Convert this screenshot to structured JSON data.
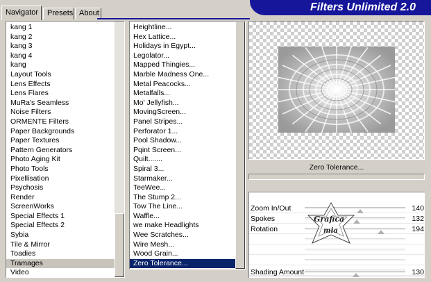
{
  "tabs": [
    {
      "label": "Navigator",
      "active": true
    },
    {
      "label": "Presets",
      "active": false
    },
    {
      "label": "About",
      "active": false
    }
  ],
  "app_title": "Filters Unlimited 2.0",
  "categories": {
    "items": [
      "kang 1",
      "kang 2",
      "kang 3",
      "kang 4",
      "kang",
      "Layout Tools",
      "Lens Effects",
      "Lens Flares",
      "MuRa's Seamless",
      "Noise Filters",
      "ORMENTE Filters",
      "Paper Backgrounds",
      "Paper Textures",
      "Pattern Generators",
      "Photo Aging Kit",
      "Photo Tools",
      "Pixellisation",
      "Psychosis",
      "Render",
      "ScreenWorks",
      "Special Effects 1",
      "Special Effects 2",
      "Sybia",
      "Tile & Mirror",
      "Toadies",
      "Tramages",
      "Video"
    ],
    "selected": "Tramages"
  },
  "filters": {
    "items": [
      "Heightline...",
      "Hex Lattice...",
      "Holidays in Egypt...",
      "Legolator...",
      "Mapped Thingies...",
      "Marble Madness One...",
      "Metal Peacocks...",
      "Metalfalls...",
      "Mo' Jellyfish...",
      "MovingScreen...",
      "Panel Stripes...",
      "Perforator 1...",
      "Pool Shadow...",
      "Pqint Screen...",
      "Quilt.......",
      "Spiral 3...",
      "Starmaker...",
      "TeeWee...",
      "The Stump 2...",
      "Tow The Line...",
      "Waffle...",
      "we make Headlights",
      "Wee Scratches...",
      "Wire Mesh...",
      "Wood Grain...",
      "Zero Tolerance..."
    ],
    "selected": "Zero Tolerance..."
  },
  "preview_filter_name": "Zero Tolerance...",
  "controls": [
    {
      "label": "Zoom In/Out",
      "value": "140",
      "level": 0.55
    },
    {
      "label": "Spokes",
      "value": "132",
      "level": 0.52
    },
    {
      "label": "Rotation",
      "value": "194",
      "level": 0.76
    },
    {
      "label": "",
      "value": "",
      "level": null
    },
    {
      "label": "",
      "value": "",
      "level": null
    },
    {
      "label": "",
      "value": "",
      "level": null
    },
    {
      "label": "",
      "value": "",
      "level": null
    },
    {
      "label": "Shading Amount",
      "value": "130",
      "level": 0.51
    }
  ],
  "watermark_text": [
    "Grafica",
    "mia"
  ],
  "colors": {
    "face": "#d4d0c8",
    "banner": "#16169a",
    "selection": "#0a246a",
    "selection_gray": "#c8c4bc"
  }
}
